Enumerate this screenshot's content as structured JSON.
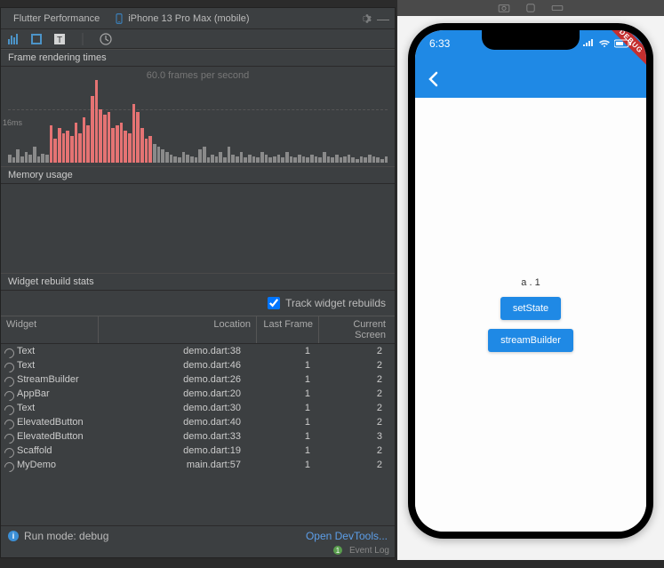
{
  "toolbar": {
    "perf_tab": "Flutter Performance",
    "device": "iPhone 13 Pro Max (mobile)"
  },
  "chart": {
    "frame_title": "Frame rendering times",
    "fps": "60.0 frames per second",
    "threshold": "16ms",
    "memory_title": "Memory usage"
  },
  "rebuild": {
    "title": "Widget rebuild stats",
    "track_label": "Track widget rebuilds",
    "cols": {
      "widget": "Widget",
      "location": "Location",
      "last_frame": "Last Frame",
      "current_screen": "Current Screen"
    },
    "rows": [
      {
        "w": "Text",
        "loc": "demo.dart:38",
        "lf": "1",
        "cs": "2"
      },
      {
        "w": "Text",
        "loc": "demo.dart:46",
        "lf": "1",
        "cs": "2"
      },
      {
        "w": "StreamBuilder",
        "loc": "demo.dart:26",
        "lf": "1",
        "cs": "2"
      },
      {
        "w": "AppBar",
        "loc": "demo.dart:20",
        "lf": "1",
        "cs": "2"
      },
      {
        "w": "Text",
        "loc": "demo.dart:30",
        "lf": "1",
        "cs": "2"
      },
      {
        "w": "ElevatedButton",
        "loc": "demo.dart:40",
        "lf": "1",
        "cs": "2"
      },
      {
        "w": "ElevatedButton",
        "loc": "demo.dart:33",
        "lf": "1",
        "cs": "3"
      },
      {
        "w": "Scaffold",
        "loc": "demo.dart:19",
        "lf": "1",
        "cs": "2"
      },
      {
        "w": "MyDemo",
        "loc": "main.dart:57",
        "lf": "1",
        "cs": "2"
      }
    ]
  },
  "footer": {
    "runmode": "Run mode: debug",
    "devtools": "Open DevTools...",
    "event_log": "Event Log",
    "event_count": "1"
  },
  "phone": {
    "time": "6:33",
    "debug": "DEBUG",
    "label": "a . 1",
    "btn1": "setState",
    "btn2": "streamBuilder"
  },
  "chart_data": {
    "type": "bar",
    "ylabel": "ms",
    "threshold_ms": 16,
    "title": "Frame rendering times",
    "values": [
      6,
      4,
      10,
      5,
      8,
      6,
      12,
      5,
      7,
      6,
      28,
      18,
      26,
      22,
      24,
      20,
      30,
      22,
      34,
      28,
      50,
      62,
      40,
      36,
      38,
      26,
      28,
      30,
      24,
      22,
      44,
      38,
      26,
      18,
      20,
      14,
      12,
      10,
      8,
      6,
      5,
      4,
      8,
      6,
      5,
      4,
      10,
      12,
      4,
      6,
      5,
      8,
      4,
      12,
      6,
      5,
      8,
      4,
      6,
      5,
      4,
      8,
      6,
      4,
      5,
      6,
      4,
      8,
      5,
      4,
      6,
      5,
      4,
      6,
      5,
      4,
      8,
      5,
      4,
      6,
      4,
      5,
      6,
      4,
      3,
      5,
      4,
      6,
      5,
      4,
      3,
      5
    ],
    "colors_high": "#e57373",
    "colors_low": "#8a8a8a"
  }
}
